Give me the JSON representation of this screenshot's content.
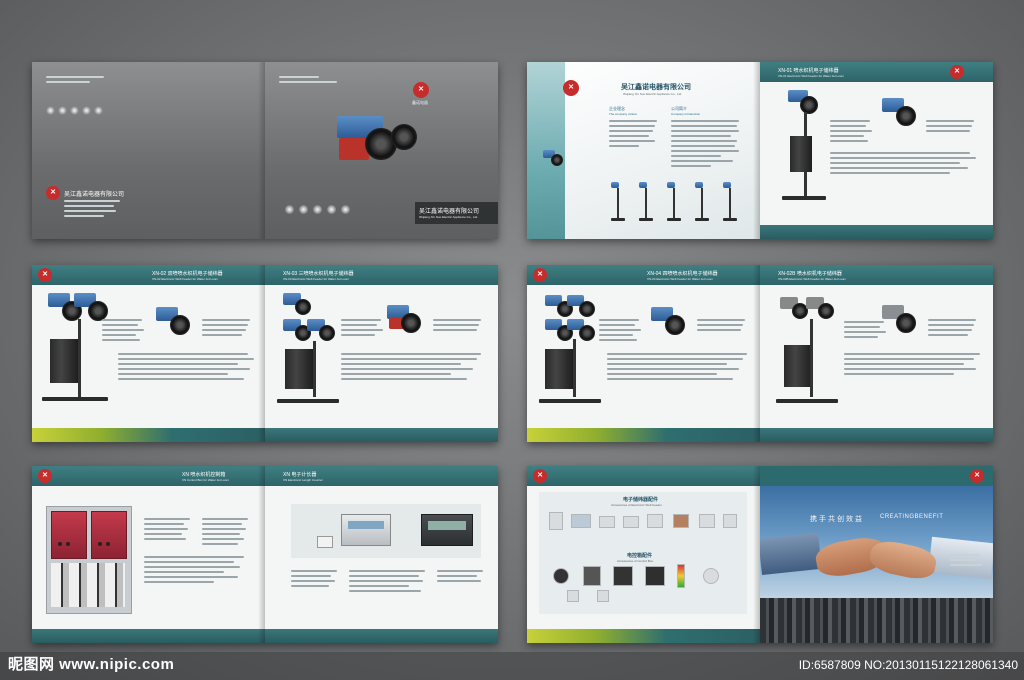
{
  "cover": {
    "company_cn": "吴江鑫诺电器有限公司",
    "company_en": "Wujiang Xin Nuo Electric Appliance Co., Ltd.",
    "back_company_cn": "吴江鑫诺电器有限公司",
    "logo_caption": "鑫诺电器"
  },
  "intro": {
    "company_cn": "吴江鑫诺电器有限公司",
    "company_en": "Wujiang Xin Nuo Electric Appliance Co., Ltd.",
    "col1_head_cn": "企业理念",
    "col1_head_en": "The company culture",
    "col2_head_cn": "公司简介",
    "col2_head_en": "Company introduction"
  },
  "product_pages": [
    {
      "code_title": "XN-01 喷水织机电子储纬器",
      "code_sub": "XN-01 Electronic Weft Feeder for Water Jet Loom"
    },
    {
      "code_title": "XN-02 双喷喷水织机电子储纬器",
      "code_sub": "XN-02 Electronic Weft Feeder for Water Jet Loom"
    },
    {
      "code_title": "XN-03 三喷喷水织机电子储纬器",
      "code_sub": "XN-03 Electronic Weft Feeder for Water Jet Loom"
    },
    {
      "code_title": "XN-04 四喷喷水织机电子储纬器",
      "code_sub": "XN-04 Electronic Weft Feeder for Water Jet Loom"
    },
    {
      "code_title": "XN-02B 喷水织机电子储纬器",
      "code_sub": "XN-02B Electronic Weft Feeder for Water Jet Loom"
    },
    {
      "code_title": "XN 喷水织机控制箱",
      "code_sub": "XN Control Box for Water Jet Loom"
    },
    {
      "code_title": "XN 电子计长器",
      "code_sub": "XN Electronic Length Counter"
    }
  ],
  "accessories": {
    "head_cn": "电子储纬器配件",
    "head_en": "Accessories of Electronic Weft Feeder",
    "head2_cn": "电控箱配件",
    "head2_en": "Accessories of Control Box"
  },
  "back": {
    "slogan_cn": "携手共创效益",
    "slogan_en": "CREATINGBENEFIT"
  },
  "watermark": {
    "site": "昵图网 www.nipic.com",
    "id": "ID:6587809 NO:20130115122128061340"
  }
}
